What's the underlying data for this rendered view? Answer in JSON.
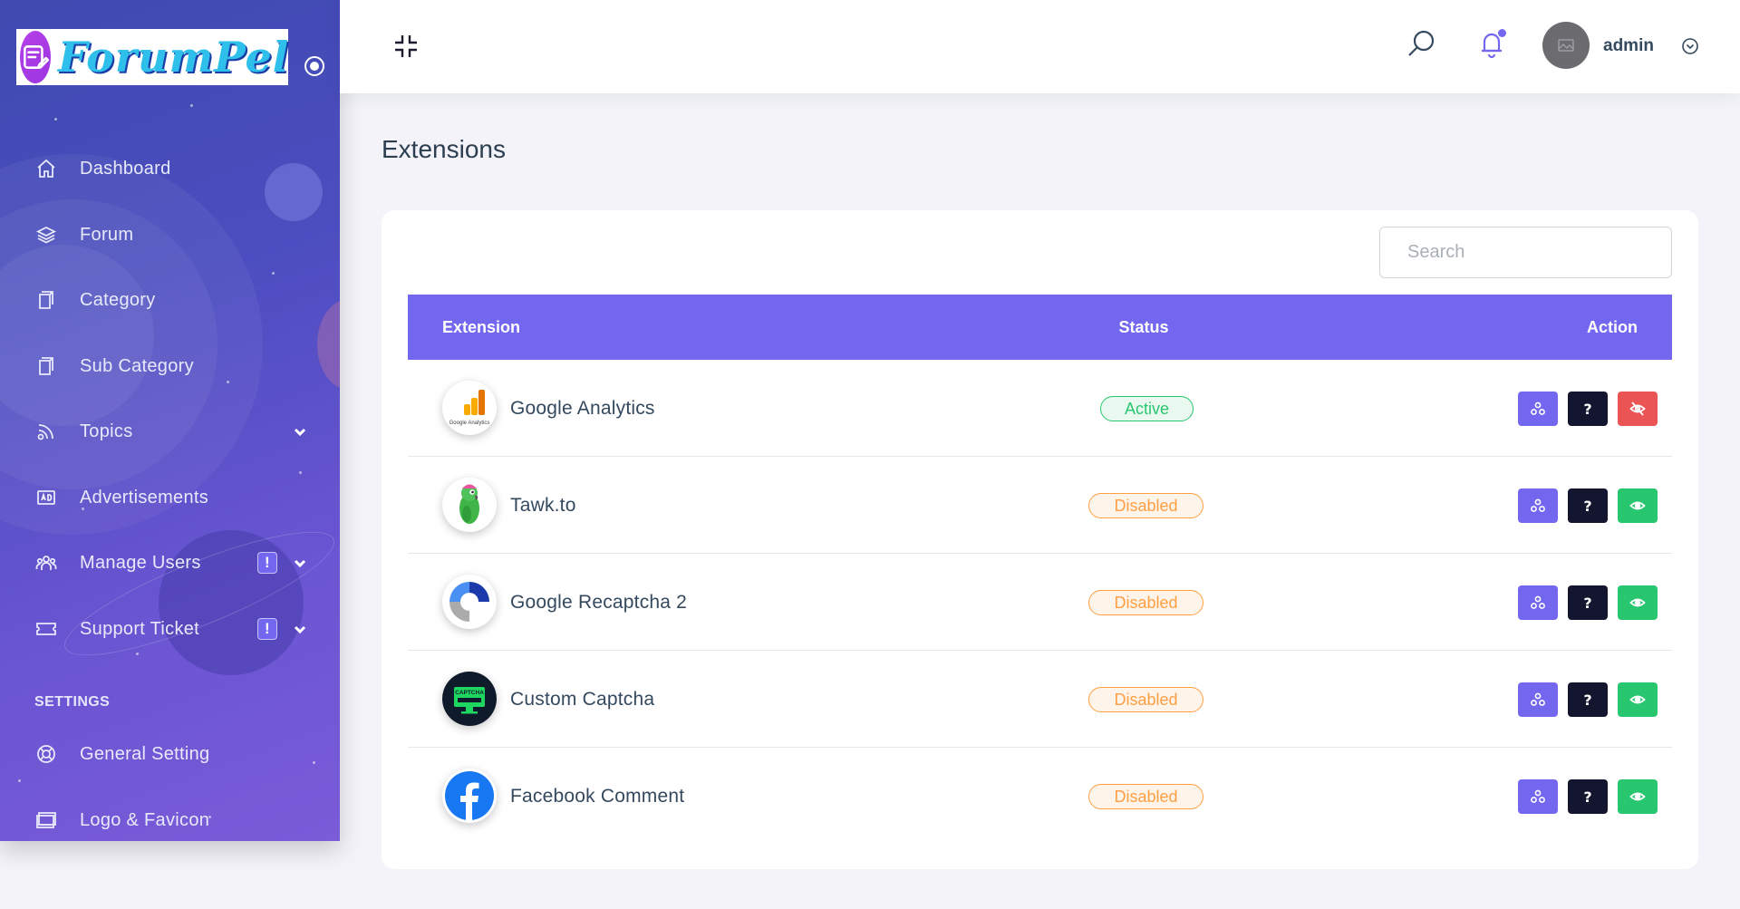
{
  "brand": {
    "name": "ForumPel"
  },
  "sidebar": {
    "items": [
      {
        "label": "Dashboard",
        "icon": "home-icon"
      },
      {
        "label": "Forum",
        "icon": "layers-icon"
      },
      {
        "label": "Category",
        "icon": "document-icon"
      },
      {
        "label": "Sub Category",
        "icon": "document-icon"
      },
      {
        "label": "Topics",
        "icon": "feed-icon"
      },
      {
        "label": "Advertisements",
        "icon": "ad-icon"
      },
      {
        "label": "Manage Users",
        "icon": "users-icon",
        "badge": "!"
      },
      {
        "label": "Support Ticket",
        "icon": "ticket-icon",
        "badge": "!"
      }
    ],
    "section_settings": "SETTINGS",
    "settings_items": [
      {
        "label": "General Setting",
        "icon": "lifebuoy-icon"
      },
      {
        "label": "Logo & Favicon",
        "icon": "monitor-icon"
      }
    ]
  },
  "header": {
    "username": "admin"
  },
  "page": {
    "title": "Extensions",
    "search_placeholder": "Search"
  },
  "table": {
    "columns": {
      "extension": "Extension",
      "status": "Status",
      "action": "Action"
    },
    "rows": [
      {
        "name": "Google Analytics",
        "status": "Active",
        "logo_caption": "Google Analytics"
      },
      {
        "name": "Tawk.to",
        "status": "Disabled"
      },
      {
        "name": "Google Recaptcha 2",
        "status": "Disabled"
      },
      {
        "name": "Custom Captcha",
        "status": "Disabled",
        "logo_caption": "CAPTCHA"
      },
      {
        "name": "Facebook Comment",
        "status": "Disabled"
      }
    ]
  },
  "colors": {
    "primary": "#7367f0",
    "dark": "#14152e",
    "success": "#28c76f",
    "danger": "#ea5455",
    "warning": "#ff9f43"
  }
}
